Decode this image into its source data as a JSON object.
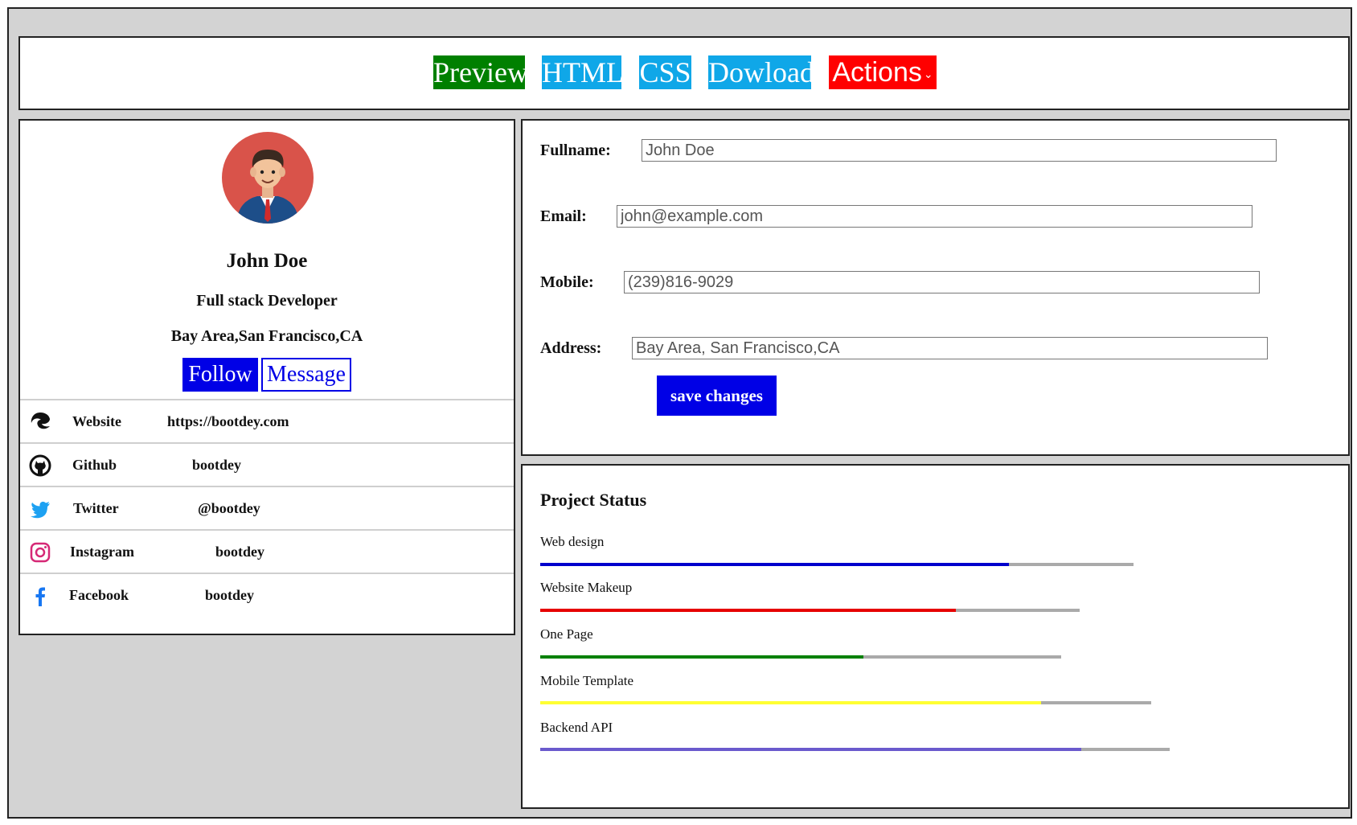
{
  "toolbar": {
    "buttons": [
      {
        "label": "Preview",
        "color": "#008000"
      },
      {
        "label": "HTML",
        "color": "#0fa7e8"
      },
      {
        "label": "CSS",
        "color": "#0fa7e8"
      },
      {
        "label": "Dowload",
        "color": "#0fa7e8"
      },
      {
        "label": "Actions",
        "color": "#ff0000"
      }
    ]
  },
  "profile": {
    "name": "John Doe",
    "role": "Full stack Developer",
    "location": "Bay Area,San Francisco,CA",
    "follow_label": "Follow",
    "message_label": "Message",
    "social": [
      {
        "icon": "edge-icon",
        "label": "Website",
        "value": "https://bootdey.com"
      },
      {
        "icon": "github-icon",
        "label": "Github",
        "value": "bootdey"
      },
      {
        "icon": "twitter-icon",
        "label": "Twitter",
        "value": "@bootdey"
      },
      {
        "icon": "instagram-icon",
        "label": "Instagram",
        "value": "bootdey"
      },
      {
        "icon": "facebook-icon",
        "label": "Facebook",
        "value": "bootdey"
      }
    ]
  },
  "form": {
    "fullname_label": "Fullname:",
    "fullname_value": "John Doe",
    "email_label": "Email:",
    "email_value": "john@example.com",
    "mobile_label": "Mobile:",
    "mobile_value": "(239)816-9029",
    "address_label": "Address:",
    "address_value": "Bay Area, San Francisco,CA",
    "save_label": "save changes"
  },
  "project_status": {
    "title": "Project Status",
    "items": [
      {
        "label": "Web design",
        "progress": 0.79,
        "color": "#0000cc"
      },
      {
        "label": "Website Makeup",
        "progress": 0.77,
        "color": "#e60000"
      },
      {
        "label": "One Page",
        "progress": 0.62,
        "color": "#008000"
      },
      {
        "label": "Mobile Template",
        "progress": 0.82,
        "color": "#ffff33"
      },
      {
        "label": "Backend API",
        "progress": 0.86,
        "color": "#6a5acd"
      }
    ]
  }
}
